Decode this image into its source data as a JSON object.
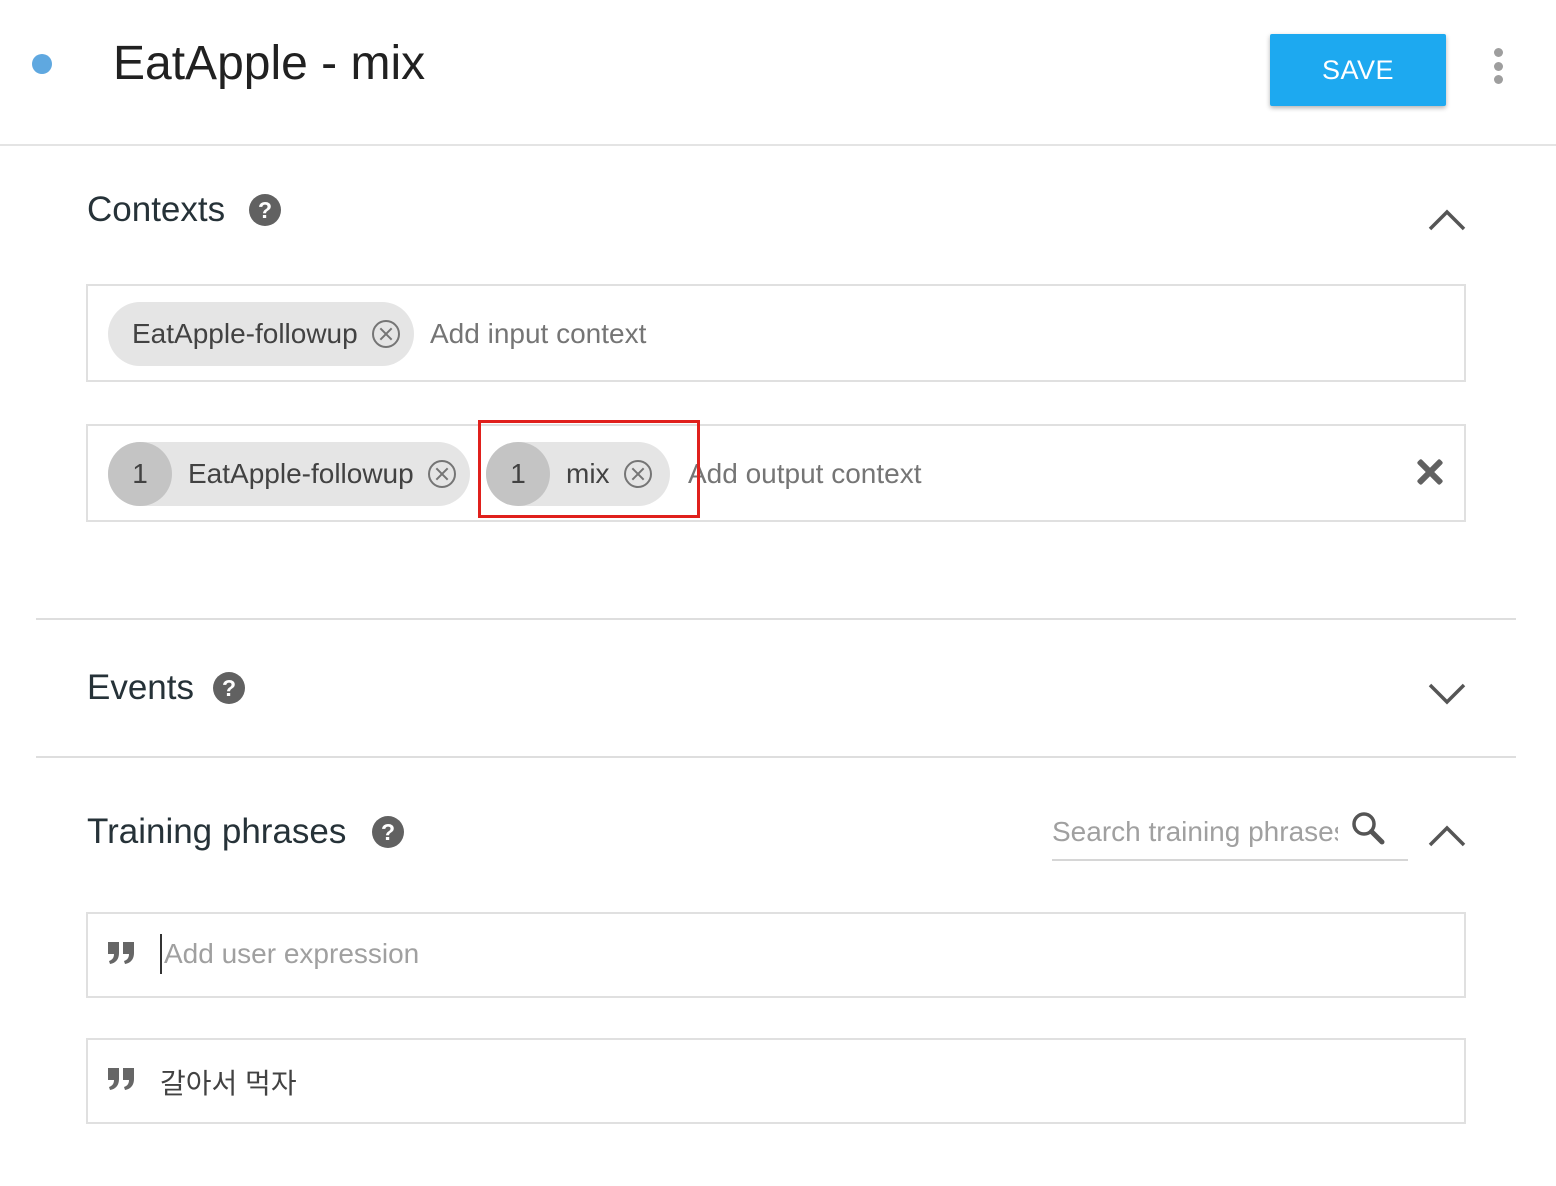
{
  "header": {
    "title": "EatApple - mix",
    "save_label": "SAVE",
    "status_dot_color": "#5fa8e0",
    "menu_icon": "more-vert-icon"
  },
  "contexts": {
    "title": "Contexts",
    "help_icon": "?",
    "expanded": true,
    "input": {
      "chips": [
        {
          "label": "EatApple-followup"
        }
      ],
      "placeholder": "Add input context"
    },
    "output": {
      "chips": [
        {
          "lifespan": "1",
          "label": "EatApple-followup"
        },
        {
          "lifespan": "1",
          "label": "mix"
        }
      ],
      "placeholder": "Add output context",
      "highlighted_chip": "mix"
    }
  },
  "events": {
    "title": "Events",
    "help_icon": "?",
    "expanded": false
  },
  "training_phrases": {
    "title": "Training phrases",
    "help_icon": "?",
    "expanded": true,
    "search_placeholder": "Search training phrases",
    "new_placeholder": "Add user expression",
    "phrases": [
      "갈아서 먹자"
    ]
  },
  "colors": {
    "accent": "#1da9f0",
    "highlight": "#e0201c"
  }
}
